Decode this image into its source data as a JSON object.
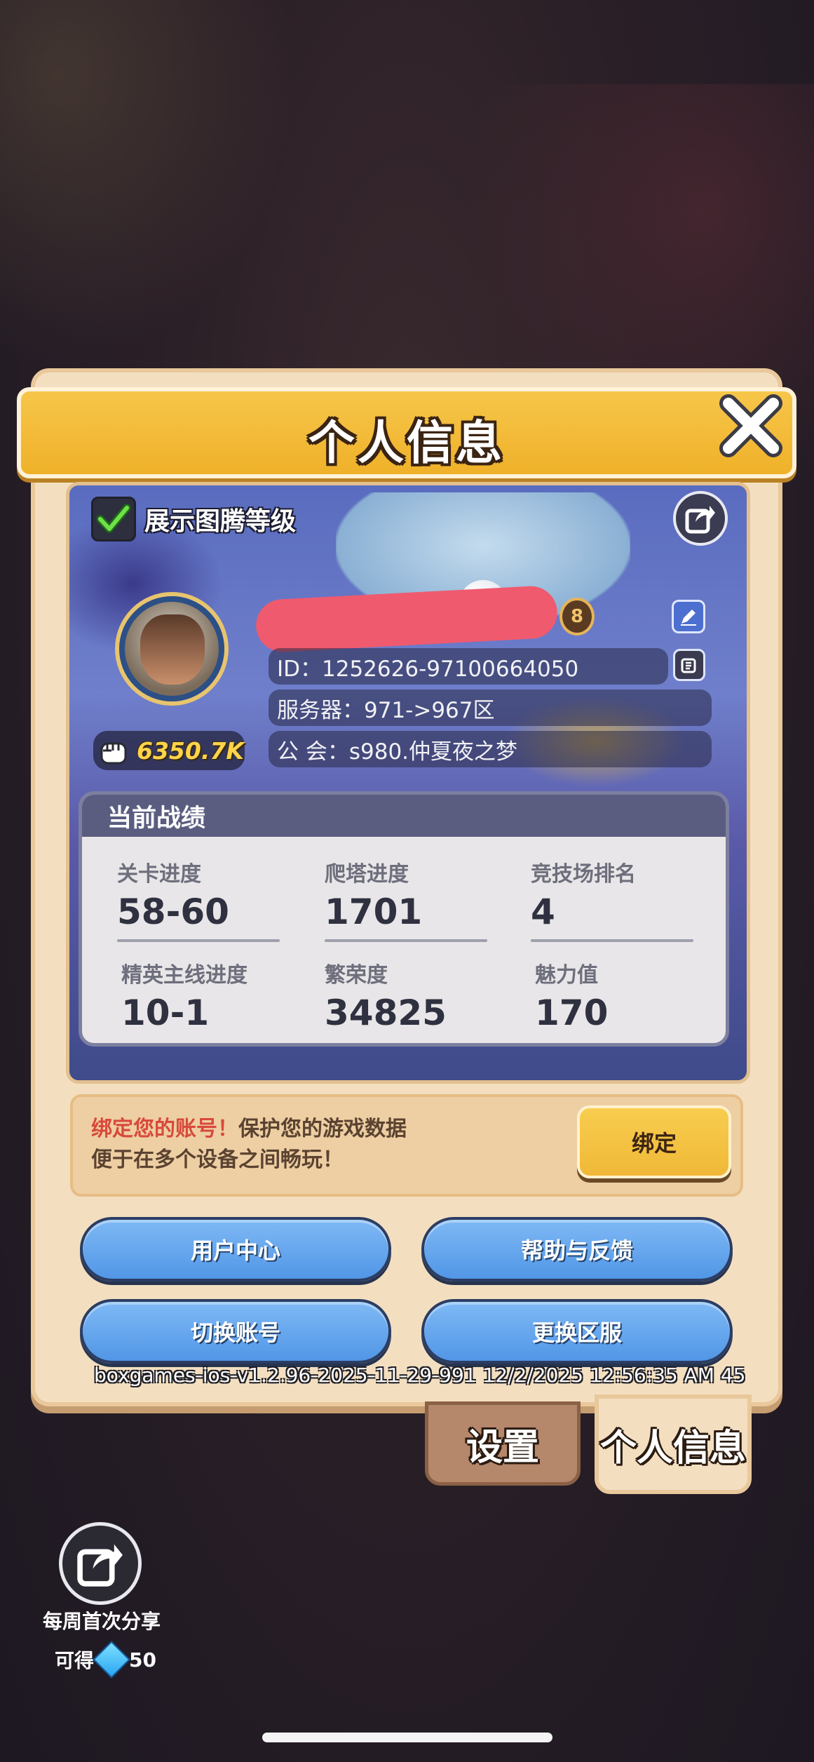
{
  "dialog": {
    "title": "个人信息",
    "show_totem_label": "展示图腾等级",
    "show_totem_checked": true
  },
  "profile": {
    "level": "8",
    "id_text": "ID：1252626-97100664050",
    "server_text": "服务器：971->967区",
    "guild_text": "公 会：s980.仲夏夜之梦",
    "power": "6350.7K"
  },
  "stats": {
    "header": "当前战绩",
    "items": [
      {
        "label": "关卡进度",
        "value": "58-60"
      },
      {
        "label": "爬塔进度",
        "value": "1701"
      },
      {
        "label": "竞技场排名",
        "value": "4"
      },
      {
        "label": "精英主线进度",
        "value": "10-1"
      },
      {
        "label": "繁荣度",
        "value": "34825"
      },
      {
        "label": "魅力值",
        "value": "170"
      }
    ]
  },
  "bind": {
    "warning": "绑定您的账号！",
    "line1_rest": "保护您的游戏数据",
    "line2": "便于在多个设备之间畅玩！",
    "button": "绑定"
  },
  "buttons": {
    "user_center": "用户中心",
    "help_feedback": "帮助与反馈",
    "switch_account": "切换账号",
    "change_server": "更换区服"
  },
  "version": "boxgames-ios-v1.2.96-2025-11-29-991 12/2/2025 12:56:35 AM 45",
  "tabs": {
    "settings": "设置",
    "profile": "个人信息"
  },
  "weekly_share": {
    "label": "每周首次分享",
    "reward_prefix": "可得",
    "reward_amount": "50"
  },
  "icons": {
    "close": "close-icon",
    "check": "check-icon",
    "share": "share-icon",
    "edit": "edit-icon",
    "copy": "copy-icon",
    "fist": "fist-icon",
    "gem": "gem-icon"
  },
  "colors": {
    "title_bar": "#f7c64a",
    "panel": "#f3dfc0",
    "blue_button": "#5f9fe8",
    "bind_button": "#f4c442",
    "power": "#ffd44a",
    "warning": "#d84a3b"
  }
}
